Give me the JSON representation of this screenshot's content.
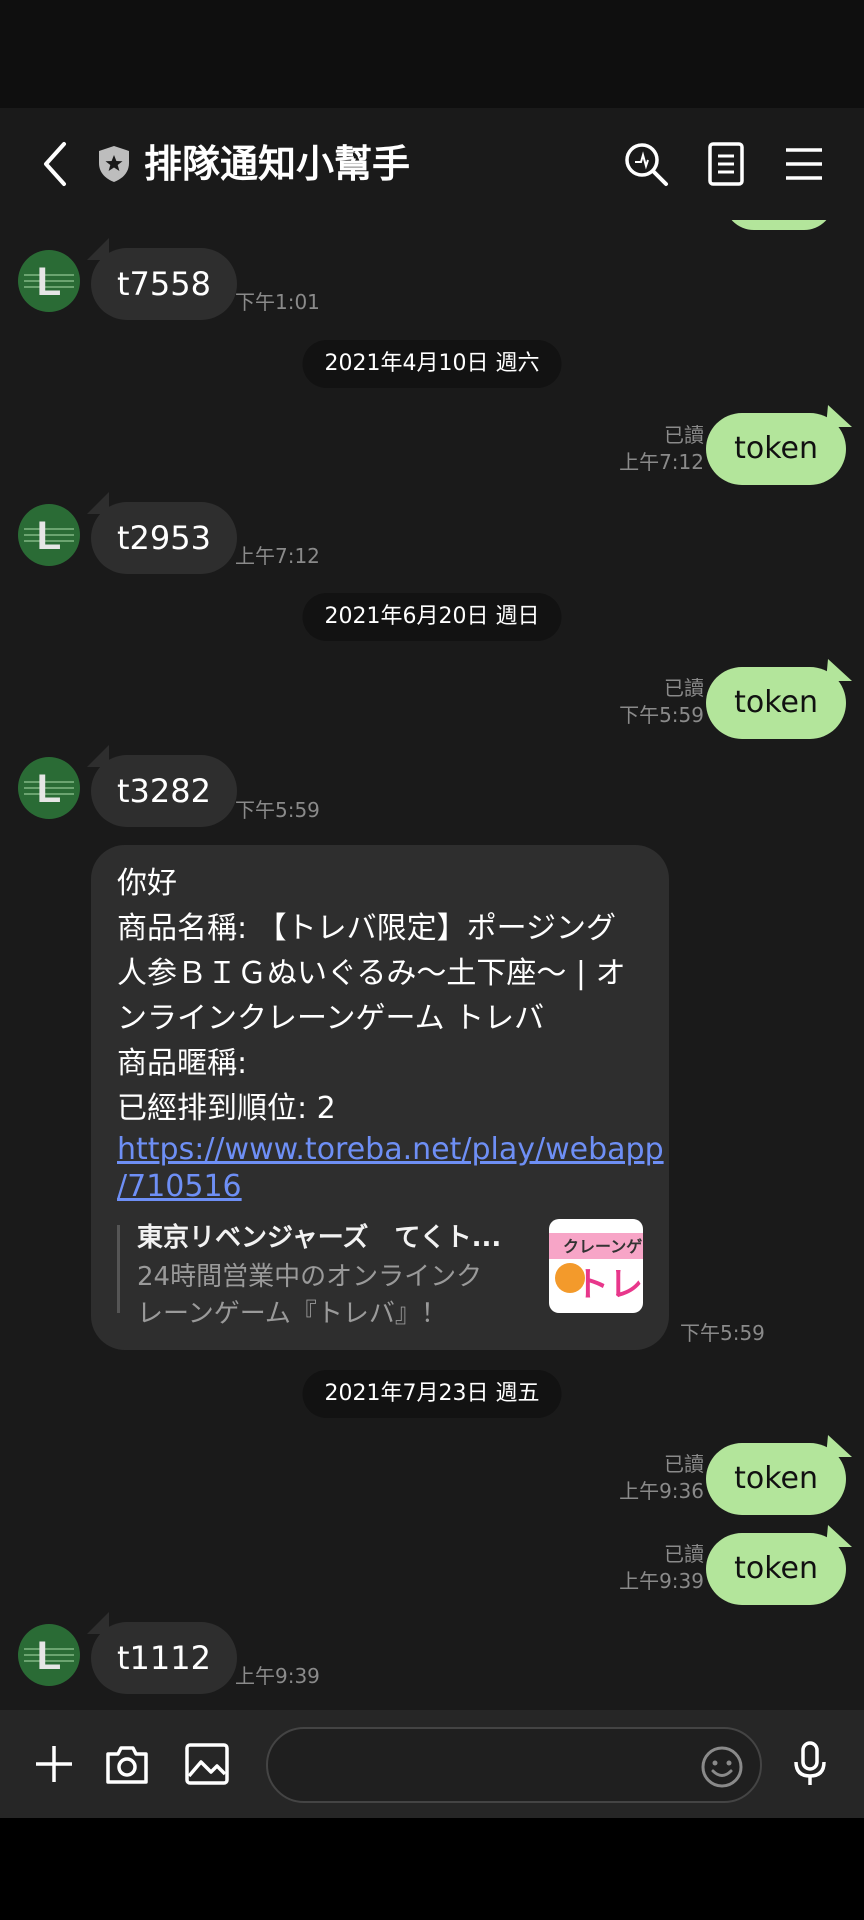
{
  "header": {
    "title": "排隊通知小幫手"
  },
  "messages": [
    {
      "type": "in",
      "text": "t7558",
      "time": "下午1:01"
    },
    {
      "type": "date",
      "text": "2021年4月10日 週六"
    },
    {
      "type": "out",
      "text": "token",
      "read": "已讀",
      "time": "上午7:12"
    },
    {
      "type": "in",
      "text": "t2953",
      "time": "上午7:12"
    },
    {
      "type": "date",
      "text": "2021年6月20日 週日"
    },
    {
      "type": "out",
      "text": "token",
      "read": "已讀",
      "time": "下午5:59"
    },
    {
      "type": "in",
      "text": "t3282",
      "time": "下午5:59"
    },
    {
      "type": "date",
      "text": "2021年7月23日 週五"
    },
    {
      "type": "out",
      "text": "token",
      "read": "已讀",
      "time": "上午9:36"
    },
    {
      "type": "out",
      "text": "token",
      "read": "已讀",
      "time": "上午9:39"
    },
    {
      "type": "in",
      "text": "t1112",
      "time": "上午9:39"
    }
  ],
  "long_message": {
    "lines": [
      "你好",
      "商品名稱: 【トレバ限定】ポージング",
      "人参ＢＩＧぬいぐるみ〜土下座〜 | オ",
      "ンラインクレーンゲーム トレバ",
      "商品暱稱:",
      "已經排到順位: 2"
    ],
    "link_lines": [
      "https://www.toreba.net/play/webapp",
      "/710516"
    ],
    "preview_title": "東京リベンジャーズ　てくト...",
    "preview_desc": [
      "24時間営業中のオンラインク",
      "レーンゲーム『トレバ』！"
    ],
    "thumb_text": "クレーンゲ",
    "thumb_logo": "トレバ",
    "time": "下午5:59"
  },
  "avatar_letter": "L",
  "composer": {
    "placeholder": ""
  },
  "colors": {
    "background": "#1a1a1a",
    "outgoing": "#b3e59b",
    "incoming": "#2e2e2e",
    "link": "#6e8ff5"
  }
}
